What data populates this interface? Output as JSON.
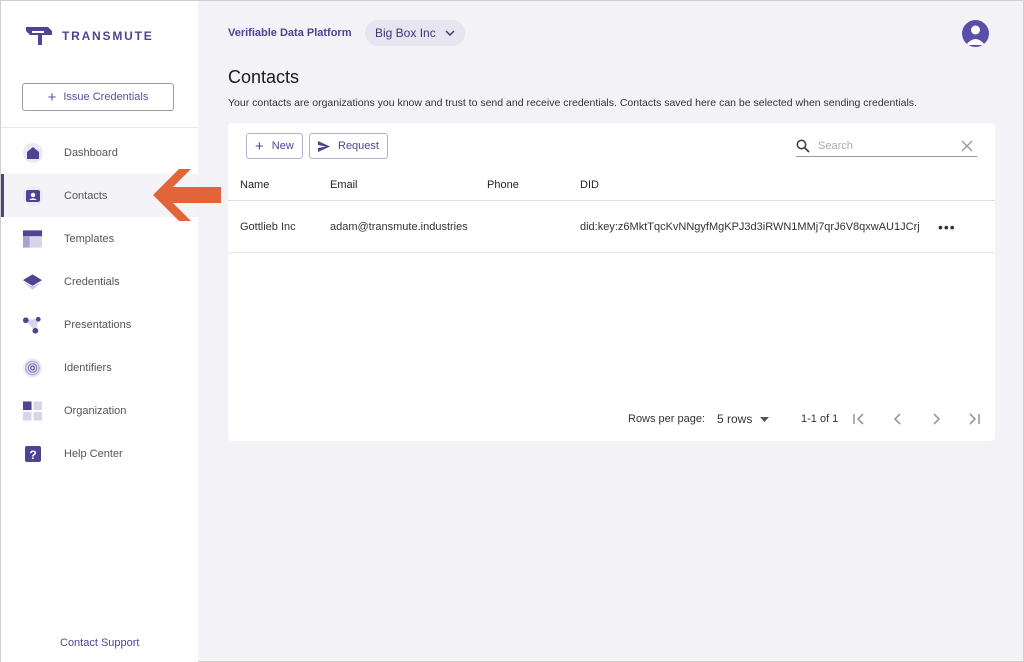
{
  "brand": {
    "name": "TRANSMUTE"
  },
  "sidebar": {
    "issue_button": "Issue Credentials",
    "items": [
      {
        "label": "Dashboard",
        "icon": "home-icon"
      },
      {
        "label": "Contacts",
        "icon": "contact-card-icon",
        "active": true
      },
      {
        "label": "Templates",
        "icon": "template-icon"
      },
      {
        "label": "Credentials",
        "icon": "layers-icon"
      },
      {
        "label": "Presentations",
        "icon": "network-icon"
      },
      {
        "label": "Identifiers",
        "icon": "fingerprint-icon"
      },
      {
        "label": "Organization",
        "icon": "grid-icon"
      },
      {
        "label": "Help Center",
        "icon": "help-icon"
      }
    ],
    "support": "Contact Support"
  },
  "header": {
    "platform": "Verifiable Data Platform",
    "org": "Big Box Inc"
  },
  "page": {
    "title": "Contacts",
    "description": "Your contacts are organizations you know and trust to send and receive credentials. Contacts saved here can be selected when sending credentials."
  },
  "toolbar": {
    "new_label": "New",
    "request_label": "Request",
    "search_placeholder": "Search"
  },
  "table": {
    "columns": [
      "Name",
      "Email",
      "Phone",
      "DID"
    ],
    "rows": [
      {
        "name": "Gottlieb Inc",
        "email": "adam@transmute.industries",
        "phone": "",
        "did": "did:key:z6MktTqcKvNNgyfMgKPJ3d3iRWN1MMj7qrJ6V8qxwAU1JCrj",
        "actions": "•••"
      }
    ]
  },
  "pagination": {
    "rows_label": "Rows per page:",
    "rows_value": "5 rows",
    "range": "1-1 of 1"
  },
  "colors": {
    "accent": "#4d4494",
    "arrow": "#e2653a",
    "background": "#f2f2f7"
  }
}
